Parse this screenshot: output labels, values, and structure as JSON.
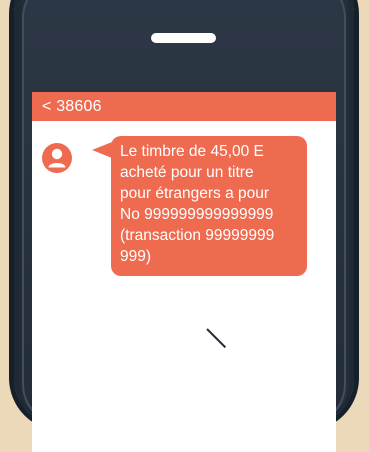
{
  "header": {
    "back_title": "< 38606"
  },
  "message": {
    "lines": [
      "Le timbre de 45,00 E",
      "acheté pour un titre",
      "pour étrangers a pour",
      "No 999999999999999",
      "(transaction 99999999",
      "999)"
    ]
  },
  "colors": {
    "accent": "#ef6b50",
    "background": "#ecd9b9",
    "phone_body": "#242e39"
  },
  "icons": {
    "avatar": "user-avatar-icon"
  }
}
